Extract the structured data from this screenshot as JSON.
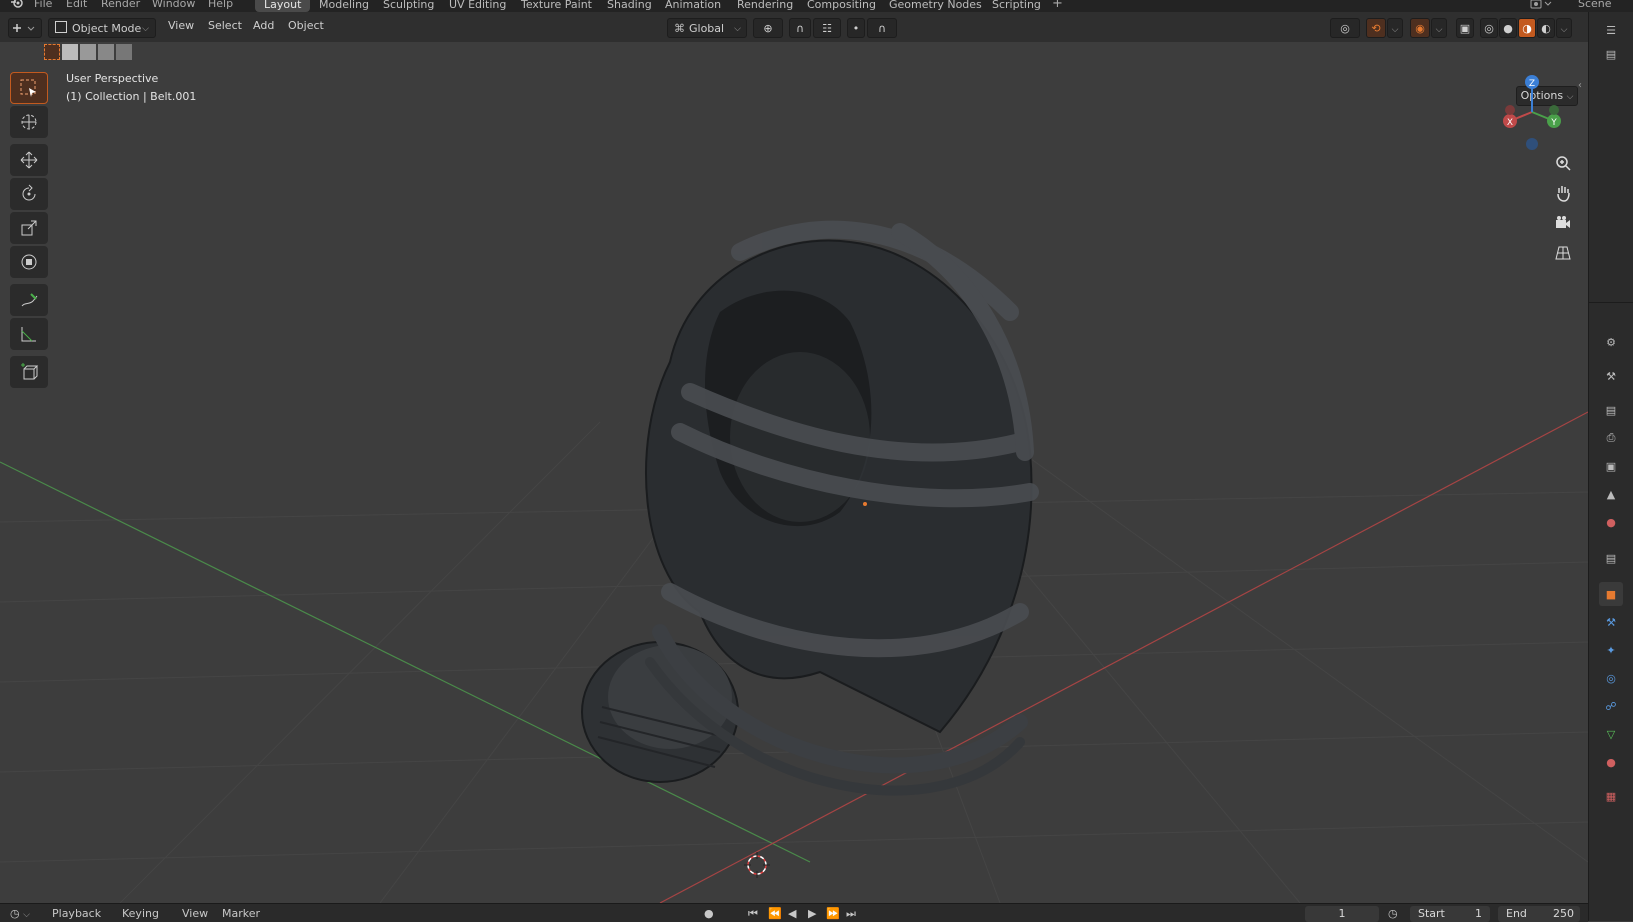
{
  "top_menu": {
    "items": [
      "File",
      "Edit",
      "Render",
      "Window",
      "Help"
    ]
  },
  "workspaces": [
    "Layout",
    "Modeling",
    "Sculpting",
    "UV Editing",
    "Texture Paint",
    "Shading",
    "Animation",
    "Rendering",
    "Compositing",
    "Geometry Nodes",
    "Scripting"
  ],
  "active_workspace": "Layout",
  "scene_label": "Scene",
  "header": {
    "mode_label": "Object Mode",
    "menus": [
      "View",
      "Select",
      "Add",
      "Object"
    ],
    "orientation_label": "Global",
    "options_label": "Options"
  },
  "viewport": {
    "perspective_label": "User Perspective",
    "collection_label": "(1) Collection | Belt.001",
    "gizmo_axes": [
      "X",
      "Y",
      "Z"
    ]
  },
  "timeline": {
    "menus": [
      "Playback",
      "Keying",
      "View",
      "Marker"
    ],
    "current_frame": "1",
    "start_label": "Start",
    "start_value": "1",
    "end_label": "End",
    "end_value": "250"
  },
  "colors": {
    "accent": "#e67a30",
    "x_axis": "#c04a4a",
    "y_axis": "#4aa04a",
    "z_axis": "#3b7fd6"
  }
}
